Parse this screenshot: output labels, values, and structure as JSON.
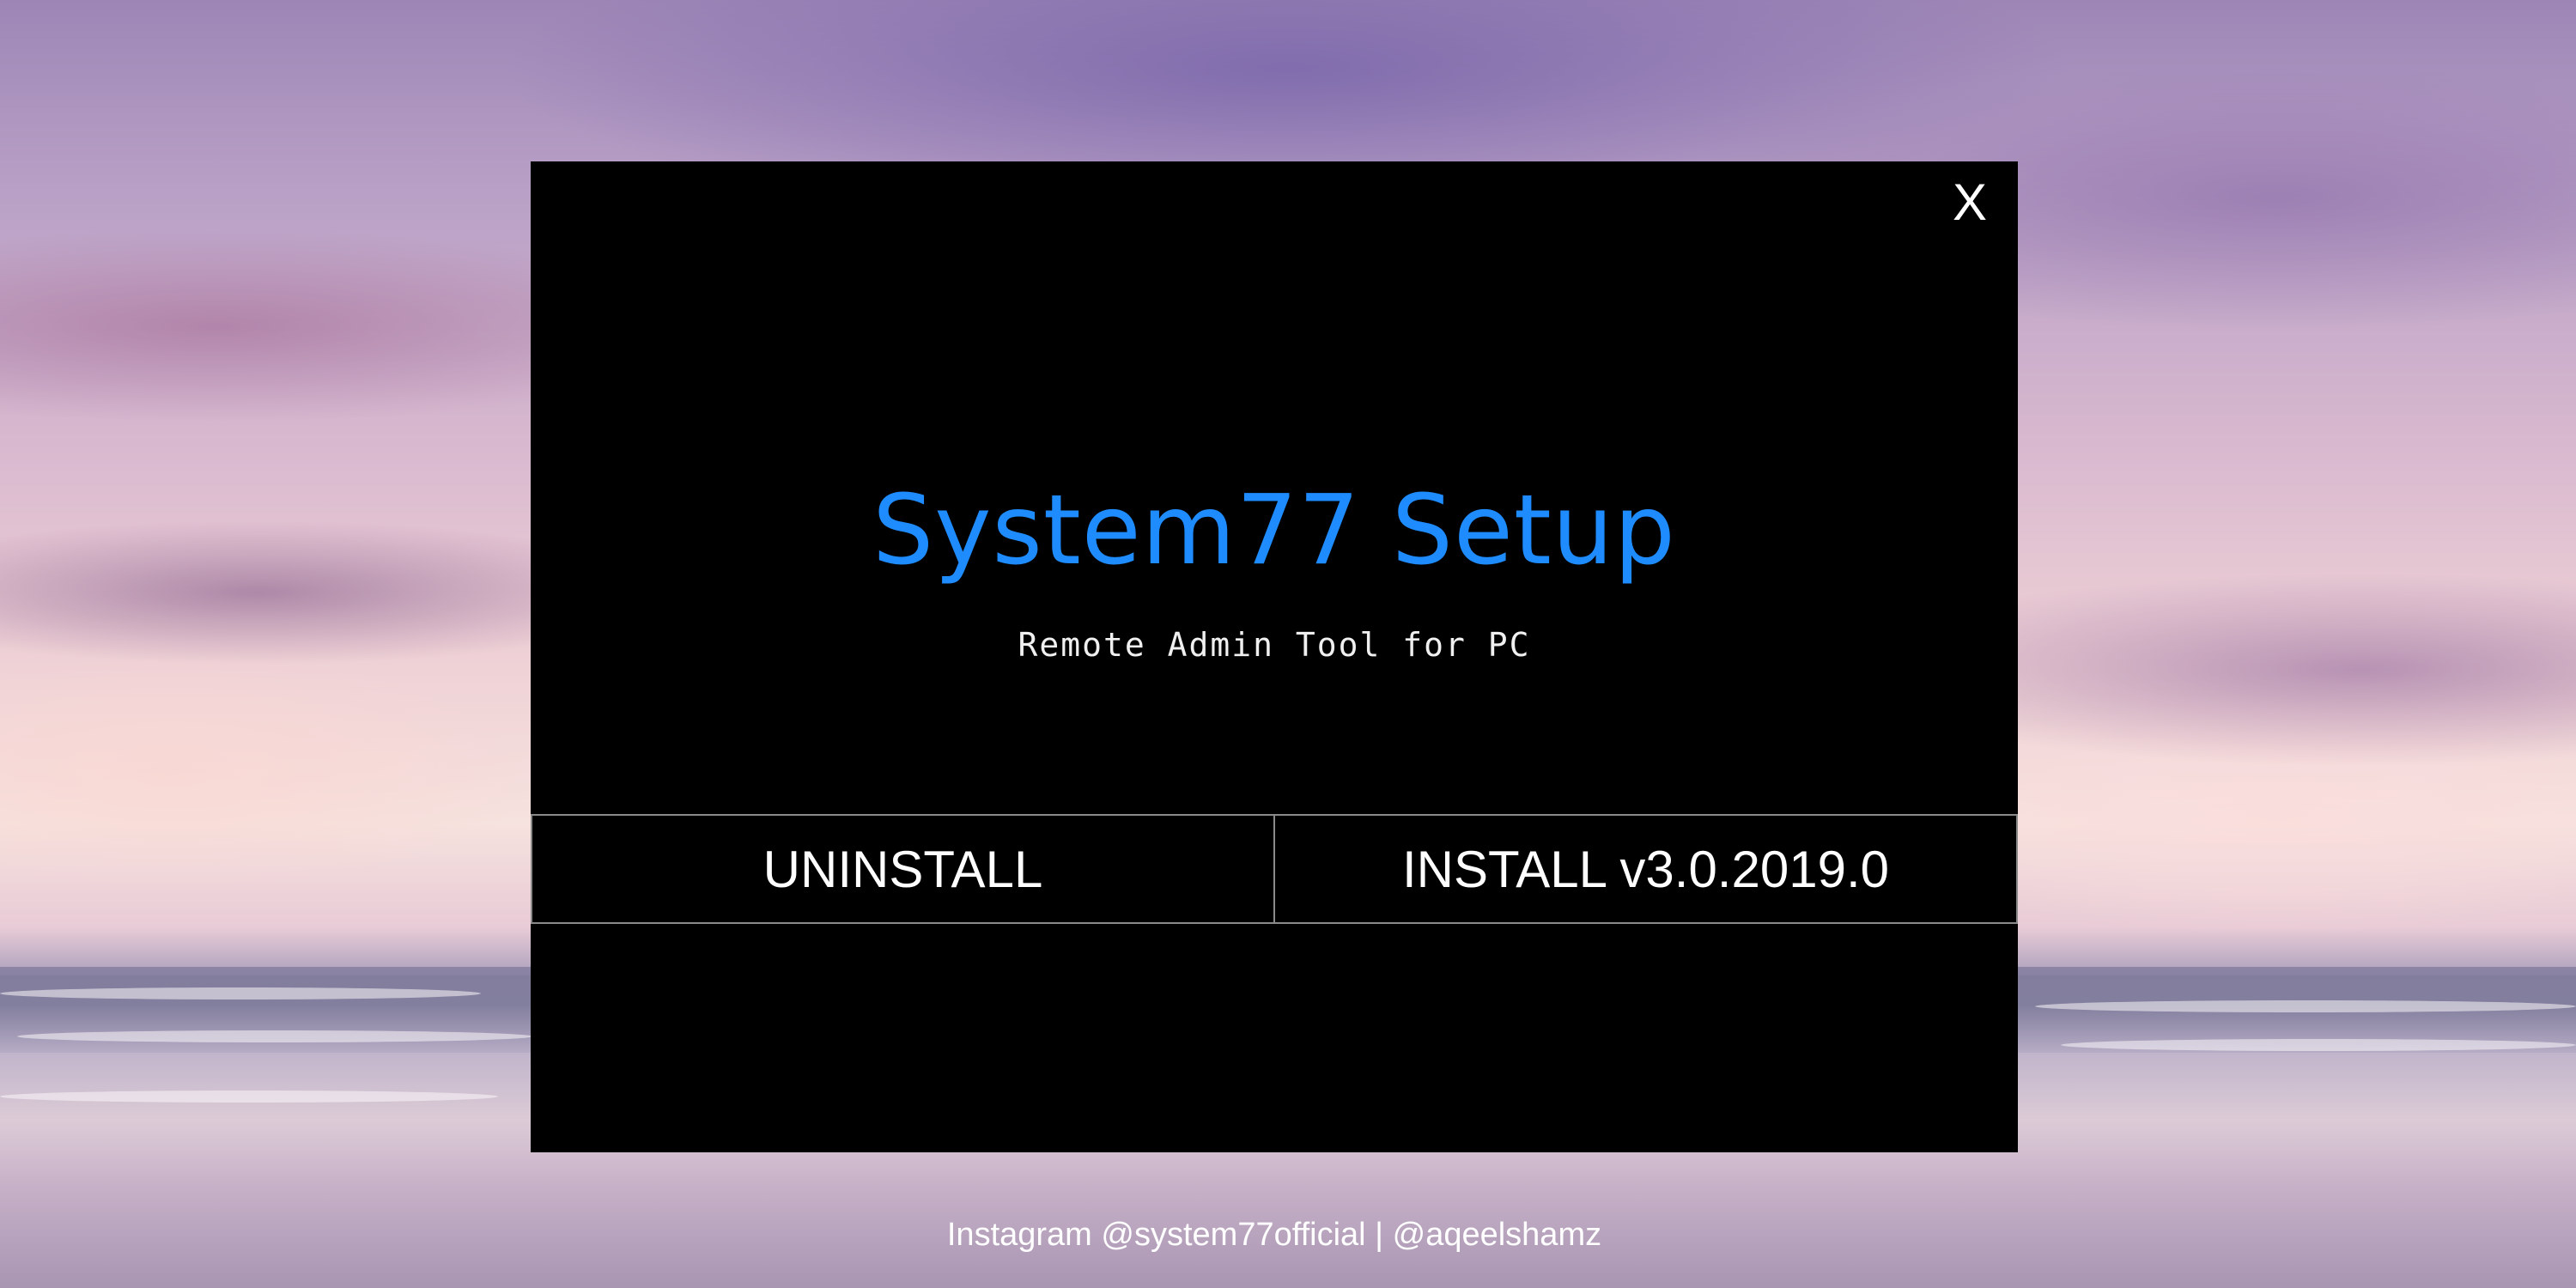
{
  "window": {
    "close_label": "X",
    "title": "System77 Setup",
    "subtitle": "Remote Admin Tool for PC",
    "uninstall_label": "UNINSTALL",
    "install_label": "INSTALL v3.0.2019.0",
    "footer": {
      "instagram_prefix": "Instagram ",
      "handle_official": "@system77official",
      "separator": " | ",
      "handle_personal": "@aqeelshamz"
    }
  },
  "colors": {
    "title": "#1e8cff",
    "window_bg": "#000000",
    "text": "#ffffff",
    "button_border": "#8a8a8a"
  }
}
